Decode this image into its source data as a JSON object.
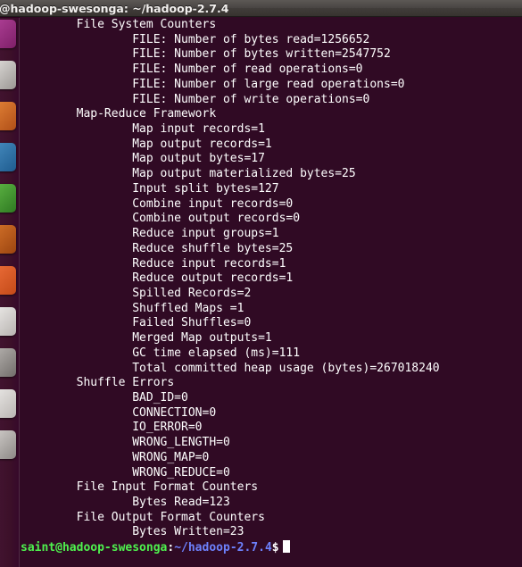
{
  "window": {
    "title": "@hadoop-swesonga: ~/hadoop-2.7.4"
  },
  "launcher": {
    "items": [
      {
        "name": "dash-home-icon",
        "label": "Dash Home",
        "glyph": "",
        "bg1": "#b5449c",
        "bg2": "#7e1f68"
      },
      {
        "name": "files-nautilus-icon",
        "label": "Files",
        "glyph": "",
        "bg1": "#e6e3e0",
        "bg2": "#9b9794"
      },
      {
        "name": "firefox-icon",
        "label": "Firefox Web Browser",
        "glyph": "",
        "bg1": "#e8883a",
        "bg2": "#b04f18"
      },
      {
        "name": "libreoffice-writer-icon",
        "label": "LibreOffice Writer",
        "glyph": "",
        "bg1": "#4a90c4",
        "bg2": "#1f5c8f"
      },
      {
        "name": "libreoffice-calc-icon",
        "label": "LibreOffice Calc",
        "glyph": "",
        "bg1": "#63bb48",
        "bg2": "#2f7a22"
      },
      {
        "name": "libreoffice-impress-icon",
        "label": "LibreOffice Impress",
        "glyph": "",
        "bg1": "#d9762c",
        "bg2": "#9c4510"
      },
      {
        "name": "ubuntu-software-icon",
        "label": "Ubuntu Software",
        "glyph": "",
        "bg1": "#f0713c",
        "bg2": "#c44a18"
      },
      {
        "name": "amazon-icon",
        "label": "Amazon",
        "glyph": "",
        "bg1": "#f2f0ee",
        "bg2": "#b8b4b1"
      },
      {
        "name": "system-settings-icon",
        "label": "System Settings",
        "glyph": "",
        "bg1": "#bdb9b6",
        "bg2": "#726e6b"
      },
      {
        "name": "text-editor-icon",
        "label": "Text Editor",
        "glyph": "",
        "bg1": "#efedeb",
        "bg2": "#bab6b3"
      },
      {
        "name": "terminal-icon",
        "label": "Terminal",
        "glyph": "",
        "bg1": "#d8d4d1",
        "bg2": "#8d8986"
      }
    ]
  },
  "terminal": {
    "lines": [
      "        File System Counters",
      "                FILE: Number of bytes read=1256652",
      "                FILE: Number of bytes written=2547752",
      "                FILE: Number of read operations=0",
      "                FILE: Number of large read operations=0",
      "                FILE: Number of write operations=0",
      "        Map-Reduce Framework",
      "                Map input records=1",
      "                Map output records=1",
      "                Map output bytes=17",
      "                Map output materialized bytes=25",
      "                Input split bytes=127",
      "                Combine input records=0",
      "                Combine output records=0",
      "                Reduce input groups=1",
      "                Reduce shuffle bytes=25",
      "                Reduce input records=1",
      "                Reduce output records=1",
      "                Spilled Records=2",
      "                Shuffled Maps =1",
      "                Failed Shuffles=0",
      "                Merged Map outputs=1",
      "                GC time elapsed (ms)=111",
      "                Total committed heap usage (bytes)=267018240",
      "        Shuffle Errors",
      "                BAD_ID=0",
      "                CONNECTION=0",
      "                IO_ERROR=0",
      "                WRONG_LENGTH=0",
      "                WRONG_MAP=0",
      "                WRONG_REDUCE=0",
      "        File Input Format Counters",
      "                Bytes Read=123",
      "        File Output Format Counters",
      "                Bytes Written=23"
    ],
    "prompt": {
      "user_host": "saint@hadoop-swesonga",
      "separator": ":",
      "path": "~/hadoop-2.7.4",
      "symbol": "$",
      "input": ""
    }
  },
  "colors": {
    "terminal_background": "#300a24",
    "launcher_background": "#3c1029",
    "titlebar_background": "#4a4644",
    "prompt_user": "#4ef24e",
    "prompt_path": "#6d81fc",
    "text": "#ffffff"
  }
}
